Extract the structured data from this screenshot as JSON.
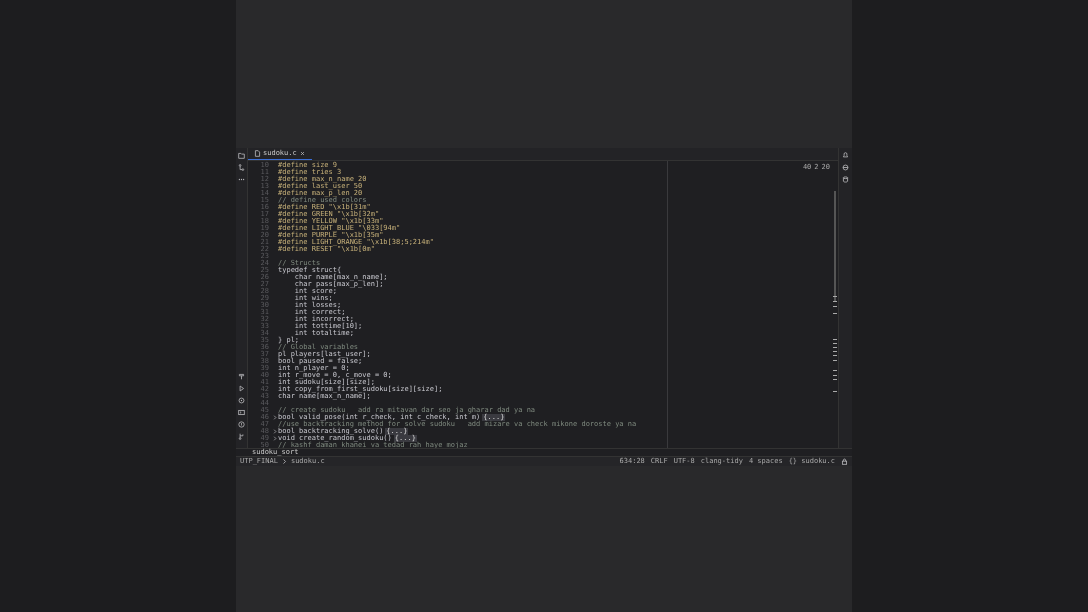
{
  "tab": {
    "label": "sudoku.c",
    "selected": true
  },
  "problems": {
    "warnings": "40",
    "infos": "2",
    "checks": "20"
  },
  "lines": [
    {
      "n": "10",
      "kind": "define",
      "text": "#define size 9"
    },
    {
      "n": "11",
      "kind": "define",
      "text": "#define tries 3"
    },
    {
      "n": "12",
      "kind": "define",
      "text": "#define max_n_name 20"
    },
    {
      "n": "13",
      "kind": "define",
      "text": "#define last_user 50"
    },
    {
      "n": "14",
      "kind": "define",
      "text": "#define max_p_len 20"
    },
    {
      "n": "15",
      "kind": "comment",
      "text": "// define used colors"
    },
    {
      "n": "16",
      "kind": "define",
      "text": "#define RED \"\\x1b[31m\""
    },
    {
      "n": "17",
      "kind": "define",
      "text": "#define GREEN \"\\x1b[32m\""
    },
    {
      "n": "18",
      "kind": "define",
      "text": "#define YELLOW \"\\x1b[33m\""
    },
    {
      "n": "19",
      "kind": "define",
      "text": "#define LIGHT_BLUE \"\\033[94m\""
    },
    {
      "n": "20",
      "kind": "define",
      "text": "#define PURPLE \"\\x1b[35m\""
    },
    {
      "n": "21",
      "kind": "define",
      "text": "#define LIGHT_ORANGE \"\\x1b[38;5;214m\""
    },
    {
      "n": "22",
      "kind": "define",
      "text": "#define RESET \"\\x1b[0m\""
    },
    {
      "n": "23",
      "kind": "blank"
    },
    {
      "n": "24",
      "kind": "comment",
      "text": "// Structs"
    },
    {
      "n": "25",
      "kind": "code",
      "text": "typedef struct{"
    },
    {
      "n": "26",
      "kind": "code",
      "text": "    char name[max_n_name];"
    },
    {
      "n": "27",
      "kind": "code",
      "text": "    char pass[max_p_len];"
    },
    {
      "n": "28",
      "kind": "code",
      "text": "    int score;"
    },
    {
      "n": "29",
      "kind": "code",
      "text": "    int wins;"
    },
    {
      "n": "30",
      "kind": "code",
      "text": "    int losses;"
    },
    {
      "n": "31",
      "kind": "code",
      "text": "    int correct;"
    },
    {
      "n": "32",
      "kind": "code",
      "text": "    int incorrect;"
    },
    {
      "n": "33",
      "kind": "code",
      "text": "    int tottime[10];"
    },
    {
      "n": "34",
      "kind": "code",
      "text": "    int totaltime;"
    },
    {
      "n": "35",
      "kind": "code",
      "text": "} pl;"
    },
    {
      "n": "36",
      "kind": "comment",
      "text": "// Global variables"
    },
    {
      "n": "37",
      "kind": "code",
      "text": "pl players[last_user];"
    },
    {
      "n": "38",
      "kind": "code",
      "text": "bool paused = false;"
    },
    {
      "n": "39",
      "kind": "code",
      "text": "int n_player = 0;"
    },
    {
      "n": "40",
      "kind": "code",
      "text": "int r_move = 0, c_move = 0;"
    },
    {
      "n": "41",
      "kind": "code",
      "text": "int sudoku[size][size];"
    },
    {
      "n": "42",
      "kind": "code",
      "text": "int copy_from_first_sudoku[size][size];"
    },
    {
      "n": "43",
      "kind": "code",
      "text": "char name[max_n_name];"
    },
    {
      "n": "44",
      "kind": "blank"
    },
    {
      "n": "45",
      "kind": "comment",
      "text": "// create sudoku   add ra mitavan dar seo ja gharar dad ya na"
    },
    {
      "n": "46",
      "kind": "code",
      "text": "bool valid_pose(int r_check, int c_check, int m)",
      "collapsed": "{...}"
    },
    {
      "n": "47",
      "kind": "comment",
      "text": "//use backtracking method for solve sudoku   add mizare va check mikone doroste ya na"
    },
    {
      "n": "48",
      "kind": "code",
      "text": "bool backtracking_solve()",
      "collapsed": "{...}"
    },
    {
      "n": "49",
      "kind": "code",
      "text": "void create_random_sudoku()",
      "collapsed": "{...}"
    },
    {
      "n": "50",
      "kind": "comment",
      "text": "// kashf daman khanei va tedad rah haye mojaz"
    }
  ],
  "sticky": "sudoku_sort",
  "breadcrumbs": [
    "UTP_FINAL",
    "sudoku.c"
  ],
  "status_bar": [
    "634:28",
    "CRLF",
    "UTF-8",
    "clang-tidy",
    "4 spaces",
    "{} sudoku.c"
  ]
}
